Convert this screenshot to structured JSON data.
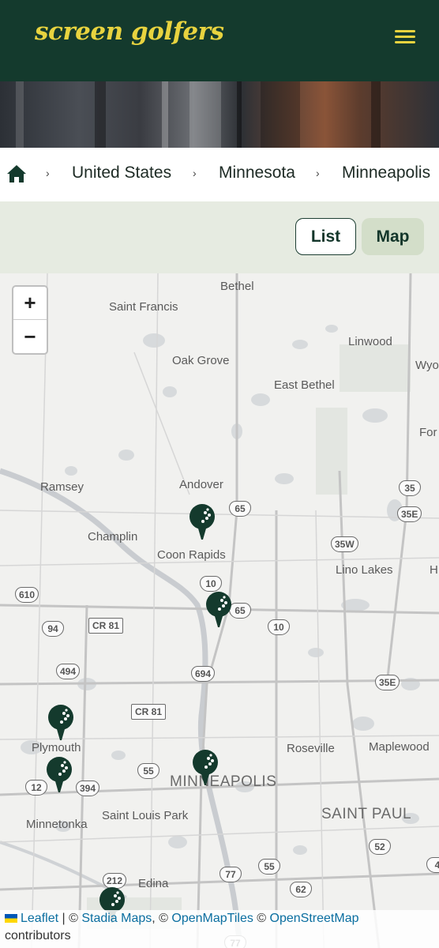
{
  "header": {
    "logo": "screen golfers",
    "menu_icon": "hamburger-menu-icon"
  },
  "breadcrumb": {
    "home_icon": "home-icon",
    "items": [
      "United States",
      "Minnesota",
      "Minneapolis"
    ],
    "separator": "›"
  },
  "view_toggle": {
    "list_label": "List",
    "map_label": "Map",
    "active": "Map"
  },
  "map": {
    "zoom_in": "+",
    "zoom_out": "−",
    "places": [
      "Bethel",
      "Saint Francis",
      "Oak Grove",
      "Linwood",
      "Wyo",
      "East Bethel",
      "For",
      "Ramsey",
      "Andover",
      "Champlin",
      "Coon Rapids",
      "Lino Lakes",
      "H",
      "Plymouth",
      "Roseville",
      "Maplewood",
      "MINNEAPOLIS",
      "SAINT PAUL",
      "Saint Louis Park",
      "Minnetonka",
      "Edina"
    ],
    "road_shields": [
      "65",
      "35",
      "35E",
      "35W",
      "610",
      "10",
      "65",
      "94",
      "CR 81",
      "10",
      "494",
      "694",
      "35E",
      "CR 81",
      "55",
      "12",
      "394",
      "52",
      "212",
      "77",
      "55",
      "62",
      "4",
      "77"
    ],
    "pin_icon": "golf-ball-tee-icon",
    "attribution": {
      "leaflet": "Leaflet",
      "sep1": " | © ",
      "stadia": "Stadia Maps",
      "sep2": ", © ",
      "omt": "OpenMapTiles",
      "sep3": " © ",
      "osm": "OpenStreetMap",
      "tail": "contributors"
    }
  },
  "colors": {
    "brand_dark": "#143a2d",
    "brand_yellow": "#e8d33f",
    "toggle_bg": "#e6ebe1",
    "active_toggle": "#d3dec9"
  }
}
